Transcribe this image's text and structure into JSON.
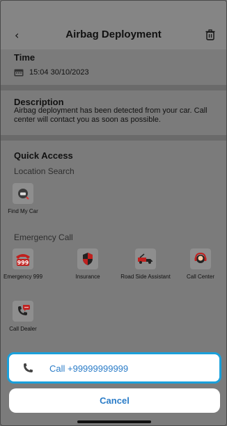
{
  "header": {
    "back_icon": "‹",
    "title": "Airbag Deployment",
    "trash_icon": "trash-icon"
  },
  "time": {
    "title": "Time",
    "value": "15:04  30/10/2023",
    "icon": "calendar-icon"
  },
  "description": {
    "title": "Description",
    "text": "Airbag deployment has been detected from your car. Call center will contact you as soon as possible."
  },
  "quick_access": {
    "title": "Quick Access",
    "location_search": {
      "title": "Location Search",
      "items": [
        {
          "label": "Find My Car",
          "icon": "car-search-icon"
        }
      ]
    },
    "emergency_call": {
      "title": "Emergency Call",
      "items": [
        {
          "label": "Emergency 999",
          "icon": "emergency-phone-icon"
        },
        {
          "label": "Insurance",
          "icon": "shield-icon"
        },
        {
          "label": "Road Side Assistant",
          "icon": "tow-truck-icon"
        },
        {
          "label": "Call Center",
          "icon": "headset-icon"
        },
        {
          "label": "Call Dealer",
          "icon": "phone-chat-icon"
        }
      ]
    }
  },
  "action_sheet": {
    "call_label": "Call +99999999999",
    "cancel_label": "Cancel",
    "accent": "#1aa0db",
    "link_color": "#2a7cc8"
  }
}
